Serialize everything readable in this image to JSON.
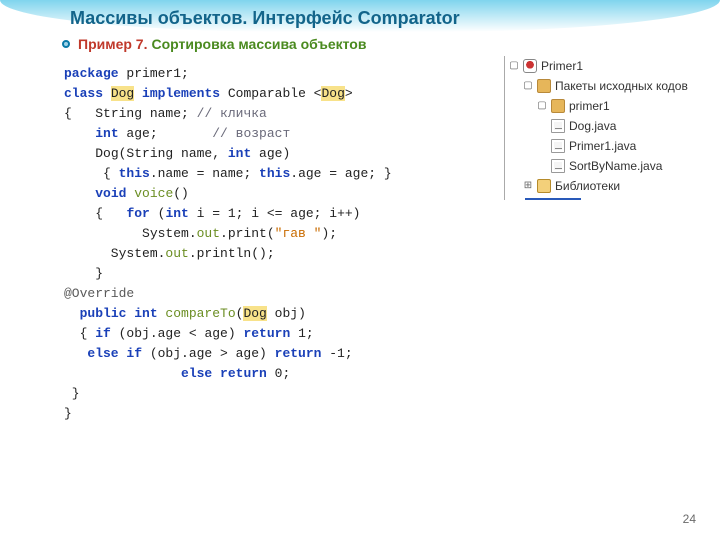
{
  "title": "Массивы объектов. Интерфейс Comparator",
  "subtitle": {
    "red": "Пример 7.",
    "green": "Сортировка массива объектов"
  },
  "page_number": "24",
  "code": {
    "l1_package": "package",
    "l1_pkgname": " primer1;",
    "l2_class": "class",
    "l2_dog": "Dog",
    "l2_impl": "implements",
    "l2_comp": " Comparable <",
    "l2_dog2": "Dog",
    "l2_end": ">",
    "l3_brace": "{   ",
    "l3_string": "String name;",
    "l3_comment": " // кличка",
    "l4_indent": "    ",
    "l4_int_kw": "int",
    "l4_age": " age;",
    "l4_comment": "       // возраст",
    "l5_indent": "    ",
    "l5_ctor": "Dog(String name, ",
    "l5_int_kw": "int",
    "l5_age": " age)",
    "l6_open": "     { ",
    "l6_this1": "this",
    "l6_t1rest": ".name = name; ",
    "l6_this2": "this",
    "l6_t2rest": ".age = age; }",
    "l7_indent": "    ",
    "l7_void": "void",
    "l7_voice": " voice",
    "l7_paren": "()",
    "l8_open": "{   ",
    "l8_for": "for",
    "l8_paren1": " (",
    "l8_intkw": "int",
    "l8_rest": " i = 1; i <= age; i++)",
    "l9_indent": "          System.",
    "l9_out": "out",
    "l9_print": ".print(",
    "l9_str": "\"гав \"",
    "l9_end": ");",
    "l10_indent": "      System.",
    "l10_out": "out",
    "l10_println": ".println();",
    "l11_brace": "}",
    "l12_ann": "@Override",
    "l13_indent": "  ",
    "l13_pubint": "public int",
    "l13_name": " compareTo",
    "l13_open": "(",
    "l13_dog": "Dog",
    "l13_rest": " obj)",
    "l14_open": "{ ",
    "l14_if": "if",
    "l14_cond": " (obj.age < age) ",
    "l14_ret": "return",
    "l14_val": " 1;",
    "l15_indent": "   ",
    "l15_else": "else if",
    "l15_cond": " (obj.age > age) ",
    "l15_ret": "return",
    "l15_val": " -1;",
    "l16_indent": "               ",
    "l16_else": "else return",
    "l16_val": " 0;",
    "l17_brace": " }",
    "l18_brace": "}"
  },
  "tree": {
    "root": "Primer1",
    "pkg_src": "Пакеты исходных кодов",
    "pkg": "primer1",
    "f1": "Dog.java",
    "f2": "Primer1.java",
    "f3": "SortByName.java",
    "lib": "Библиотеки"
  }
}
